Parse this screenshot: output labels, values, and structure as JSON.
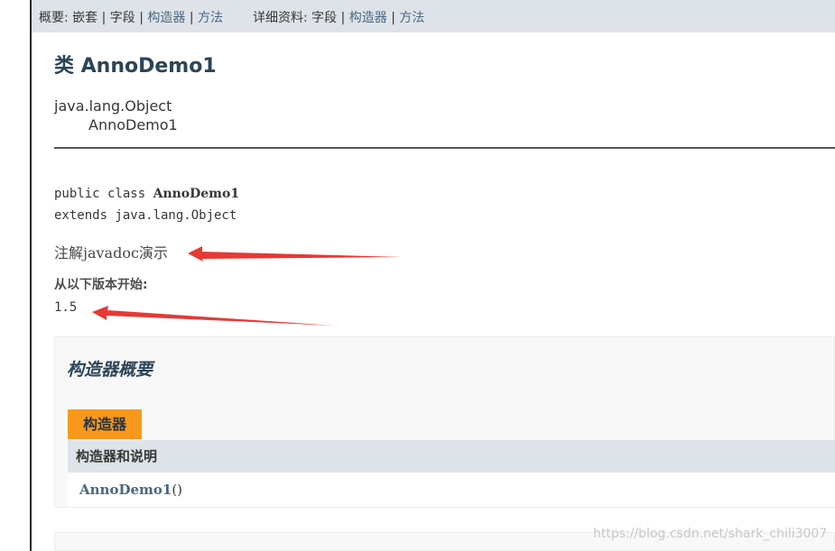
{
  "subnav": {
    "summary_label": "概要: ",
    "summary_items": [
      "嵌套",
      "字段",
      "构造器",
      "方法"
    ],
    "detail_label": "详细资料: ",
    "detail_items": [
      "字段",
      "构造器",
      "方法"
    ],
    "separator": " | "
  },
  "class": {
    "title": "类 AnnoDemo1",
    "inheritance": [
      "java.lang.Object",
      "AnnoDemo1"
    ],
    "signature_prefix": "public class ",
    "signature_name": "AnnoDemo1",
    "signature_extends": "extends java.lang.Object",
    "description": "注解javadoc演示",
    "since_label": "从以下版本开始:",
    "since_value": "1.5"
  },
  "constructor_summary": {
    "heading": "构造器概要",
    "tab_caption": "构造器",
    "column_header": "构造器和说明",
    "rows": [
      {
        "name": "AnnoDemo1",
        "params": "()"
      }
    ]
  },
  "watermark": "https://blog.csdn.net/shark_chili3007",
  "colors": {
    "nav_bg": "#dee3e9",
    "caption_bg": "#f8981d",
    "link": "#4a6782",
    "title": "#2c4557",
    "arrow": "#e53935"
  }
}
